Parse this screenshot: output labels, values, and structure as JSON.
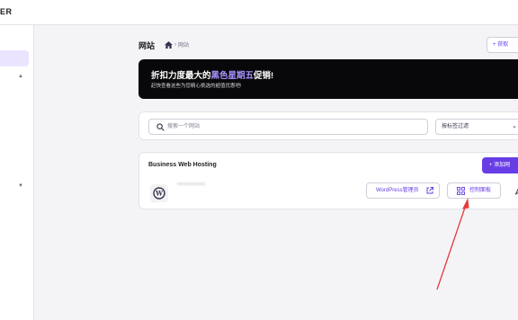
{
  "app": {
    "brand": "ER"
  },
  "header": {
    "title": "网站",
    "breadcrumb": "网站",
    "add_button_label": "+ 获取"
  },
  "banner": {
    "title_before": "折扣力度最大的",
    "title_highlight": "黑色星期五",
    "title_after": "促销!",
    "subtitle": "赶快查看这些为您精心挑选的超值优惠吧!"
  },
  "filters": {
    "search_placeholder": "搜索一个网站",
    "filter_label": "按标签过滤"
  },
  "hosting": {
    "plan_title": "Business Web Hosting",
    "add_site_label": "+ 添加网",
    "site_domain": "•••••••••••••",
    "wp_admin_label": "WordPress管理员",
    "dashboard_label": "控制面板"
  },
  "colors": {
    "accent": "#673de6",
    "annotation": "#e5393b"
  }
}
